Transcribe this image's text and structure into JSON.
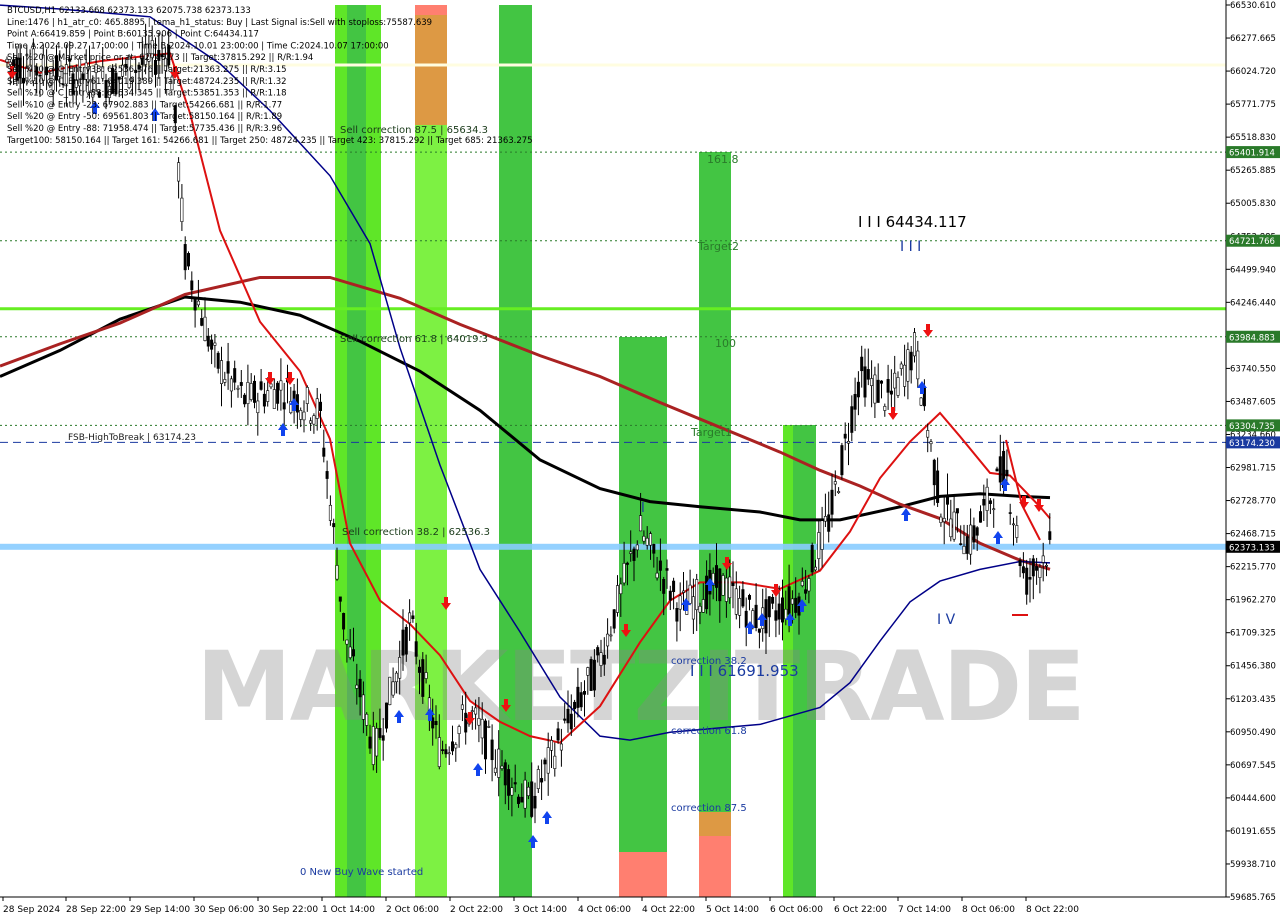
{
  "header_lines": [
    "BTCUSD,H1  62133.668 62373.133 62075.738 62373.133",
    "Line:1476 | h1_atr_c0: 465.8895 | tema_h1_status: Buy | Last Signal is:Sell with stoploss:75587.639",
    "Point A:66419.859 | Point B:60135.906 | Point C:64434.117",
    "Time A:2024.09.27 17:00:00 | Time B:2024.10.01 23:00:00 | Time C:2024.10.07 17:00:00",
    "Sell %20 @ Market price or at: 62748.73 || Target:37815.292 || R/R:1.94",
    "Sell %10 @ C_Entry38: 62536.376 || Target:21363.275 || R/R:3.15",
    "Sell %10 @ C_Entry61: 64019.389 || Target:48724.235 || R/R:1.32",
    "Sell %10 @ C_Entry88: 65634.345 || Target:53851.353 || R/R:1.18",
    "Sell %10 @ Entry -23: 67902.883 || Target:54266.681 || R/R:1.77",
    "Sell %20 @ Entry -50: 69561.803 || Target:58150.164 || R/R:1.89",
    "Sell %20 @ Entry -88: 71958.474 || Target:57735.436 || R/R:3.96",
    "Target100: 58150.164 || Target 161: 54266.681 || Target 250: 48724.235 || Target 423: 37815.292 || Target 685: 21363.275"
  ],
  "watermark": "MARKETZITRADE",
  "colors": {
    "green_zone": "#22bb22",
    "lime_zone": "#66ee22",
    "orange_zone": "#dd9944",
    "salmon_zone": "#ff7f70",
    "ema_red": "#dd1111",
    "ema_dark_red": "#aa2222",
    "ema_black": "#000000",
    "ema_navy": "#000088",
    "hline_green": "#2a7a2a",
    "hline_blue": "#1a3aa0",
    "price_band": "#88ccff"
  },
  "price_axis_ticks": [
    "66530.610",
    "66277.665",
    "66024.720",
    "65771.775",
    "65518.830",
    "65265.885",
    "65005.830",
    "64752.885",
    "64499.940",
    "64246.440",
    "63993.495",
    "63740.550",
    "63487.605",
    "63234.660",
    "62981.715",
    "62728.770",
    "62468.715",
    "62215.770",
    "61962.270",
    "61709.325",
    "61456.380",
    "61203.435",
    "60950.490",
    "60697.545",
    "60444.600",
    "60191.655",
    "59938.710",
    "59685.765"
  ],
  "price_tags": [
    {
      "label": "65401.914",
      "color": "#2a7a2a",
      "price": 65401.914
    },
    {
      "label": "64721.766",
      "color": "#2a7a2a",
      "price": 64721.766
    },
    {
      "label": "63984.883",
      "color": "#2a7a2a",
      "price": 63984.883
    },
    {
      "label": "63304.735",
      "color": "#2a7a2a",
      "price": 63304.735
    },
    {
      "label": "63174.230",
      "color": "#1a3aa0",
      "price": 63174.23
    },
    {
      "label": "62373.133",
      "color": "#000000",
      "price": 62373.133
    }
  ],
  "time_axis_labels": [
    "28 Sep 2024",
    "28 Sep 22:00",
    "29 Sep 14:00",
    "30 Sep 06:00",
    "30 Sep 22:00",
    "1 Oct 14:00",
    "2 Oct 06:00",
    "2 Oct 22:00",
    "3 Oct 14:00",
    "4 Oct 06:00",
    "4 Oct 22:00",
    "5 Oct 14:00",
    "6 Oct 06:00",
    "6 Oct 22:00",
    "7 Oct 14:00",
    "8 Oct 06:00",
    "8 Oct 22:00"
  ],
  "annotations": {
    "sell_correction_875": "Sell correction 87.5 | 65634.3",
    "sell_correction_618": "Sell correction 61.8 | 64019.3",
    "sell_correction_382": "Sell correction 38.2 | 62536.3",
    "fsb_high": "FSB-HighToBreak | 63174.23",
    "target_1618": "161.8",
    "target2": "Target2",
    "target_100": "100",
    "target1": "Target1",
    "wave_III_high": "I I I 64434.117",
    "wave_III_mark": "I I I",
    "wave_I_mark": "I",
    "wave_IV_mark": "I V",
    "correction_382": "correction 38.2",
    "wave_III_low": "I I I 61691.953",
    "correction_618": "correction 61.8",
    "correction_875": "correction 87.5",
    "new_buy_wave": "0 New Buy Wave started"
  },
  "chart_data": {
    "type": "candlestick",
    "symbol": "BTCUSD",
    "timeframe": "H1",
    "ohlc_last": {
      "open": 62133.668,
      "high": 62373.133,
      "low": 62075.738,
      "close": 62373.133
    },
    "ylim": [
      59685.765,
      66530.61
    ],
    "horizontal_levels": [
      {
        "price": 66070,
        "color": "#fffde0",
        "style": "solid"
      },
      {
        "price": 65401.914,
        "style": "dotted",
        "color": "#2a7a2a"
      },
      {
        "price": 64721.766,
        "style": "dotted",
        "color": "#2a7a2a"
      },
      {
        "price": 64200,
        "style": "solid",
        "color": "#66ee22"
      },
      {
        "price": 63984.883,
        "style": "dotted",
        "color": "#2a7a2a"
      },
      {
        "price": 63304.735,
        "style": "dotted",
        "color": "#2a7a2a"
      },
      {
        "price": 63174.23,
        "style": "dashed",
        "color": "#1a3aa0",
        "label": "FSB-HighToBreak"
      },
      {
        "price": 62373.133,
        "style": "band",
        "color": "#88ccff"
      }
    ]
  }
}
